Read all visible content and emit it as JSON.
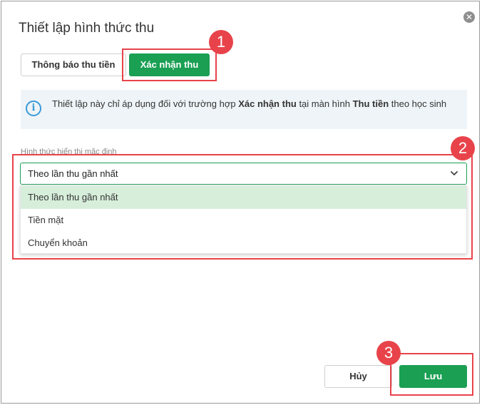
{
  "dialog": {
    "title": "Thiết lập hình thức thu",
    "close_symbol": "✕"
  },
  "tabs": [
    {
      "label": "Thông báo thu tiền",
      "active": false
    },
    {
      "label": "Xác nhận thu",
      "active": true
    }
  ],
  "info": {
    "icon": "info-icon",
    "icon_glyph": "i",
    "text_before": "Thiết lập này chỉ áp dụng đối với trường hợp ",
    "bold1": "Xác nhận thu",
    "text_middle": " tại màn hình ",
    "bold2": "Thu tiền",
    "text_after": " theo học sinh"
  },
  "field": {
    "label": "Hình thức hiển thị mặc định",
    "value": "Theo lần thu gần nhất",
    "options": [
      "Theo lần thu gần nhất",
      "Tiền mặt",
      "Chuyển khoản"
    ]
  },
  "footer": {
    "cancel_label": "Hủy",
    "save_label": "Lưu"
  },
  "annotations": [
    "1",
    "2",
    "3"
  ],
  "colors": {
    "primary": "#1a9f53",
    "highlight": "#e8434a",
    "selected_option_bg": "#d7eedb",
    "info_bg": "#eef4f8",
    "info_icon": "#3b9ad9"
  }
}
